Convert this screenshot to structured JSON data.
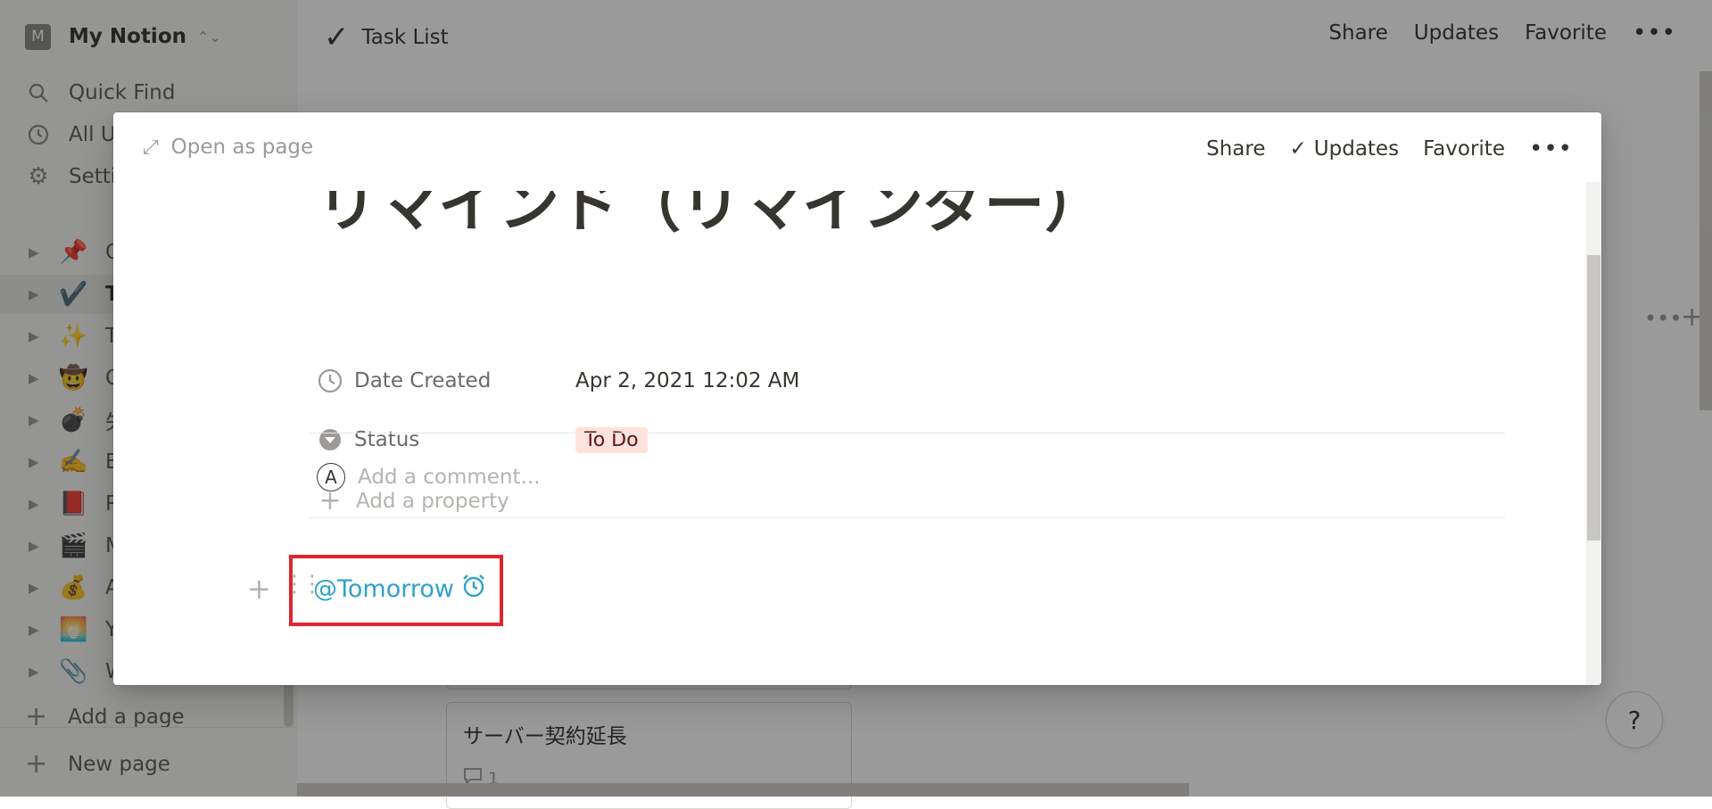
{
  "sidebar": {
    "workspace": {
      "initial": "M",
      "name": "My Notion",
      "switch_icon": "chevron-updown-icon"
    },
    "nav": [
      {
        "label": "Quick Find",
        "icon": "search-icon"
      },
      {
        "label": "All U",
        "icon": "clock-icon"
      },
      {
        "label": "Setti",
        "icon": "gear-icon"
      }
    ],
    "pages": [
      {
        "emoji": "📌",
        "label": "Q"
      },
      {
        "emoji": "✔️",
        "label": "Ta",
        "active": true
      },
      {
        "emoji": "✨",
        "label": "Th"
      },
      {
        "emoji": "🤠",
        "label": "C"
      },
      {
        "emoji": "💣",
        "label": "失"
      },
      {
        "emoji": "✍️",
        "label": "Bl"
      },
      {
        "emoji": "📕",
        "label": "Re"
      },
      {
        "emoji": "🎬",
        "label": "M"
      },
      {
        "emoji": "💰",
        "label": "A"
      },
      {
        "emoji": "🌅",
        "label": "Ye"
      },
      {
        "emoji": "📎",
        "label": "W"
      }
    ],
    "add_page": "Add a page",
    "new_page": "New page"
  },
  "topbar": {
    "title": "Task List",
    "share": "Share",
    "updates": "Updates",
    "favorite": "Favorite"
  },
  "board": {
    "card_title": "サーバー契約延長",
    "card_comments": "1"
  },
  "help": "?",
  "modal": {
    "open_as_page": "Open as page",
    "share": "Share",
    "updates": "Updates",
    "favorite": "Favorite",
    "title": "リマインド（リマインダー）",
    "properties": [
      {
        "name": "Date Created",
        "value": "Apr 2, 2021 12:02 AM",
        "icon": "clock-icon"
      },
      {
        "name": "Status",
        "value": "To Do",
        "icon": "select-icon"
      }
    ],
    "add_property": "Add a property",
    "comment_avatar": "A",
    "comment_placeholder": "Add a comment...",
    "reminder": "@Tomorrow",
    "colors": {
      "accent": "#2ea3c7",
      "highlight": "#e0252e",
      "tag_bg": "#ffe2dd"
    }
  }
}
